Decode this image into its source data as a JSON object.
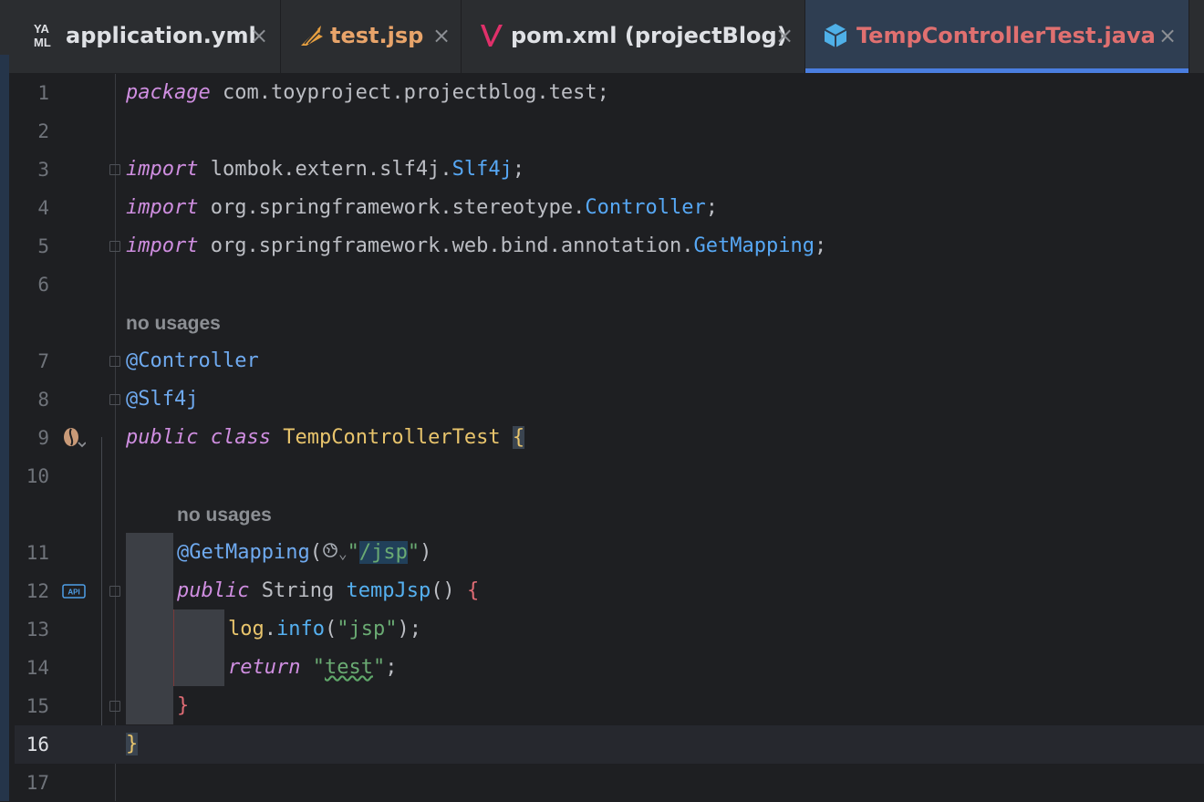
{
  "tabs": [
    {
      "label": "application.yml",
      "icon": "yaml-icon",
      "color": "#dfe1e5",
      "active": false,
      "close": "×"
    },
    {
      "label": "test.jsp",
      "icon": "jsp-icon",
      "color": "#e8a46a",
      "active": false,
      "close": "×"
    },
    {
      "label": "pom.xml (projectBlog)",
      "icon": "maven-icon",
      "color": "#dfe1e5",
      "active": false,
      "close": "×"
    },
    {
      "label": "TempControllerTest.java",
      "icon": "java-class-icon",
      "color": "#e07070",
      "active": true,
      "close": "×"
    }
  ],
  "yaml_icon_text": {
    "top": "YA",
    "bottom": "ML"
  },
  "api_badge_text": "API",
  "editor": {
    "line_numbers": [
      "1",
      "2",
      "3",
      "4",
      "5",
      "6",
      "7",
      "8",
      "9",
      "10",
      "11",
      "12",
      "13",
      "14",
      "15",
      "16",
      "17"
    ],
    "current_line": "16",
    "hints": [
      "no usages",
      "no usages"
    ],
    "code": {
      "l1_kw": "package",
      "l1_rest": " com.toyproject.projectblog.test;",
      "l3_kw": "import",
      "l3_pkg": " lombok.extern.slf4j.",
      "l3_type": "Slf4j",
      "l3_end": ";",
      "l4_kw": "import",
      "l4_pkg": " org.springframework.stereotype.",
      "l4_type": "Controller",
      "l4_end": ";",
      "l5_kw": "import",
      "l5_pkg": " org.springframework.web.bind.annotation.",
      "l5_type": "GetMapping",
      "l5_end": ";",
      "l7_ann": "@Controller",
      "l8_ann": "@Slf4j",
      "l9_kw1": "public",
      "l9_kw2": "class",
      "l9_cls": "TempControllerTest",
      "l9_brace": "{",
      "l11_ann": "@GetMapping",
      "l11_open": "(",
      "l11_chev": "⌄",
      "l11_q1": "\"",
      "l11_path": "/jsp",
      "l11_q2": "\"",
      "l11_close": ")",
      "l12_kw": "public",
      "l12_type": "String",
      "l12_fn": "tempJsp",
      "l12_paren": "()",
      "l12_brace": "{",
      "l13_obj": "log",
      "l13_dot": ".",
      "l13_fn": "info",
      "l13_args_open": "(",
      "l13_str": "\"jsp\"",
      "l13_end": ");",
      "l14_kw": "return",
      "l14_q1": "\"",
      "l14_str": "test",
      "l14_q2": "\"",
      "l14_end": ";",
      "l15_brace": "}",
      "l16_brace": "}"
    }
  },
  "colors": {
    "keyword": "#cf8ee0",
    "type": "#57a8f5",
    "annotation": "#6faaf0",
    "string": "#6aab73",
    "class_name": "#e8c46c",
    "tab_active_underline": "#4a7ee0"
  }
}
